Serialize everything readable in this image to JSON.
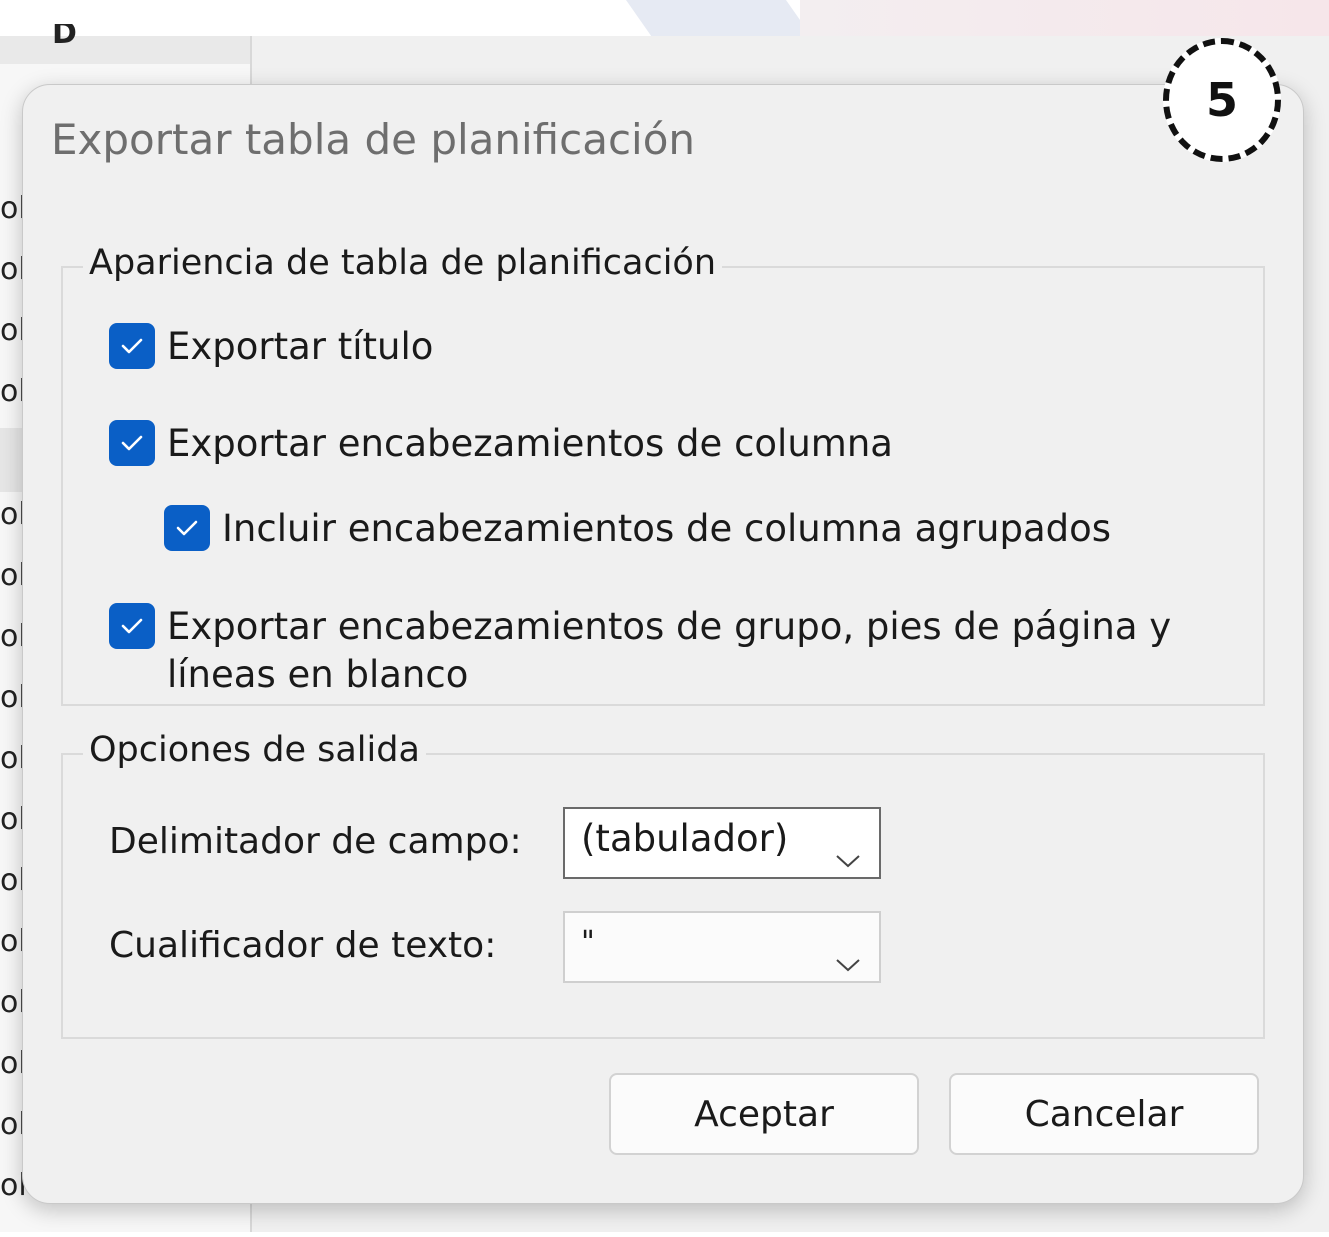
{
  "dialog": {
    "title": "Exportar tabla de planificación",
    "step_number": "5"
  },
  "appearance": {
    "legend": "Apariencia de tabla de planificación",
    "options": [
      {
        "label": "Exportar título",
        "checked": true
      },
      {
        "label": "Exportar encabezamientos de columna",
        "checked": true
      },
      {
        "label": "Incluir encabezamientos de columna agrupados",
        "checked": true
      },
      {
        "label": "Exportar encabezamientos de grupo, pies de página y líneas en blanco",
        "checked": true
      }
    ]
  },
  "output": {
    "legend": "Opciones de salida",
    "field_delimiter_label": "Delimitador de campo:",
    "field_delimiter_value": "(tabulador)",
    "text_qualifier_label": "Cualificador de texto:",
    "text_qualifier_value": "\""
  },
  "buttons": {
    "ok": "Aceptar",
    "cancel": "Cancelar"
  },
  "background": {
    "top_letter": "D",
    "row_glyph": "ol"
  },
  "colors": {
    "accent": "#0a5fc6",
    "dialog_bg": "#f0f0f0",
    "title_text": "#6e6e6e"
  }
}
